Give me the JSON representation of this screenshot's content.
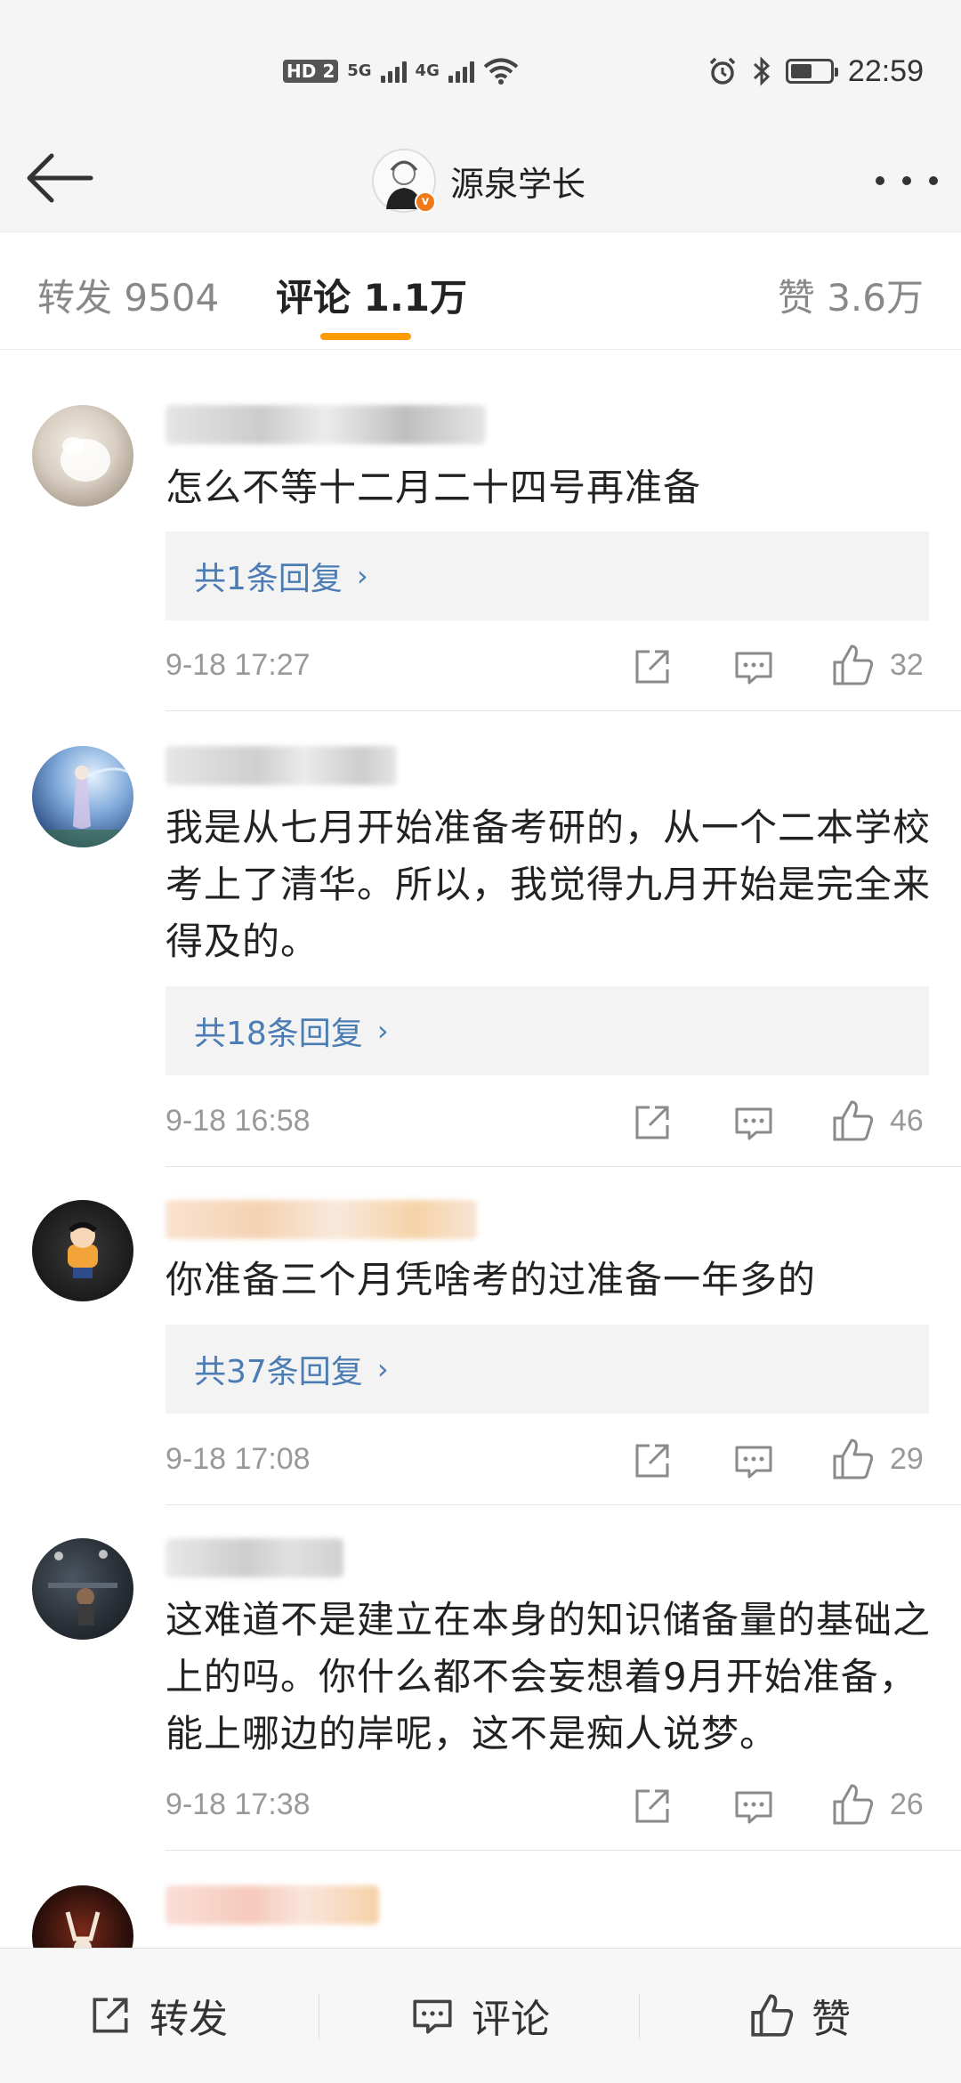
{
  "status_bar": {
    "hd": "HD",
    "sim": "2",
    "net1": "5G",
    "net2": "4G",
    "time": "22:59",
    "battery_level": 0.55
  },
  "header": {
    "title": "源泉学长",
    "verified_badge": "v"
  },
  "tabs": [
    {
      "label": "转发 9504"
    },
    {
      "label": "评论 1.1万"
    },
    {
      "label": "赞 3.6万"
    }
  ],
  "comments": [
    {
      "text": "怎么不等十二月二十四号再准备",
      "replies": "共1条回复",
      "time": "9-18 17:27",
      "likes": "32"
    },
    {
      "text": "我是从七月开始准备考研的，从一个二本学校考上了清华。所以，我觉得九月开始是完全来得及的。",
      "replies": "共18条回复",
      "time": "9-18 16:58",
      "likes": "46"
    },
    {
      "text": "你准备三个月凭啥考的过准备一年多的",
      "replies": "共37条回复",
      "time": "9-18 17:08",
      "likes": "29"
    },
    {
      "text": "这难道不是建立在本身的知识储备量的基础之上的吗。你什么都不会妄想着9月开始准备，能上哪边的岸呢，这不是痴人说梦。",
      "time": "9-18 17:38",
      "likes": "26"
    }
  ],
  "reply_chevron": "›",
  "bottom_bar": {
    "repost": "转发",
    "comment": "评论",
    "like": "赞"
  },
  "colors": {
    "accent": "#ff9a00",
    "link": "#4b7cb4",
    "badge": "#f07a1a"
  }
}
